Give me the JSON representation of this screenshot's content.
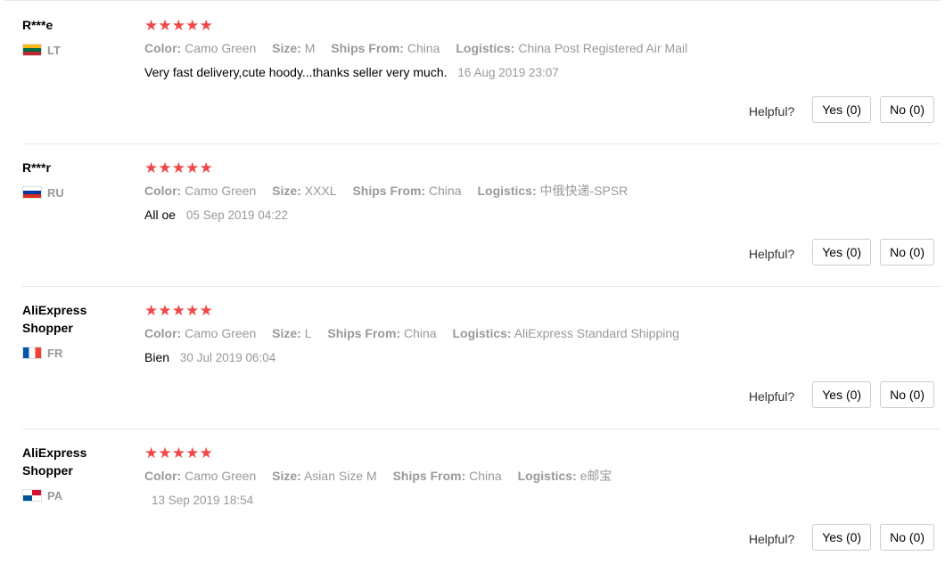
{
  "helpful_label": "Helpful?",
  "labels": {
    "color": "Color:",
    "size": "Size:",
    "ships_from": "Ships From:",
    "logistics": "Logistics:"
  },
  "star_glyph": "★",
  "reviews": [
    {
      "name": "R***e",
      "country": "LT",
      "flag": "lithuania-flag-icon",
      "rating": 5,
      "color": "Camo Green",
      "size": "M",
      "ships_from": "China",
      "logistics": "China Post Registered Air Mail",
      "text": "Very fast delivery,cute hoody...thanks seller very much.",
      "date": "16 Aug 2019 23:07",
      "yes": "Yes (0)",
      "no": "No (0)"
    },
    {
      "name": "R***r",
      "country": "RU",
      "flag": "russia-flag-icon",
      "rating": 5,
      "color": "Camo Green",
      "size": "XXXL",
      "ships_from": "China",
      "logistics": "中俄快递-SPSR",
      "text": "All oe",
      "date": "05 Sep 2019 04:22",
      "yes": "Yes (0)",
      "no": "No (0)"
    },
    {
      "name": "AliExpress Shopper",
      "country": "FR",
      "flag": "france-flag-icon",
      "rating": 5,
      "color": "Camo Green",
      "size": "L",
      "ships_from": "China",
      "logistics": "AliExpress Standard Shipping",
      "text": "Bien",
      "date": "30 Jul 2019 06:04",
      "yes": "Yes (0)",
      "no": "No (0)"
    },
    {
      "name": "AliExpress Shopper",
      "country": "PA",
      "flag": "panama-flag-icon",
      "rating": 5,
      "color": "Camo Green",
      "size": "Asian Size M",
      "ships_from": "China",
      "logistics": "e邮宝",
      "text": "",
      "date": "13 Sep 2019 18:54",
      "yes": "Yes (0)",
      "no": "No (0)"
    }
  ]
}
